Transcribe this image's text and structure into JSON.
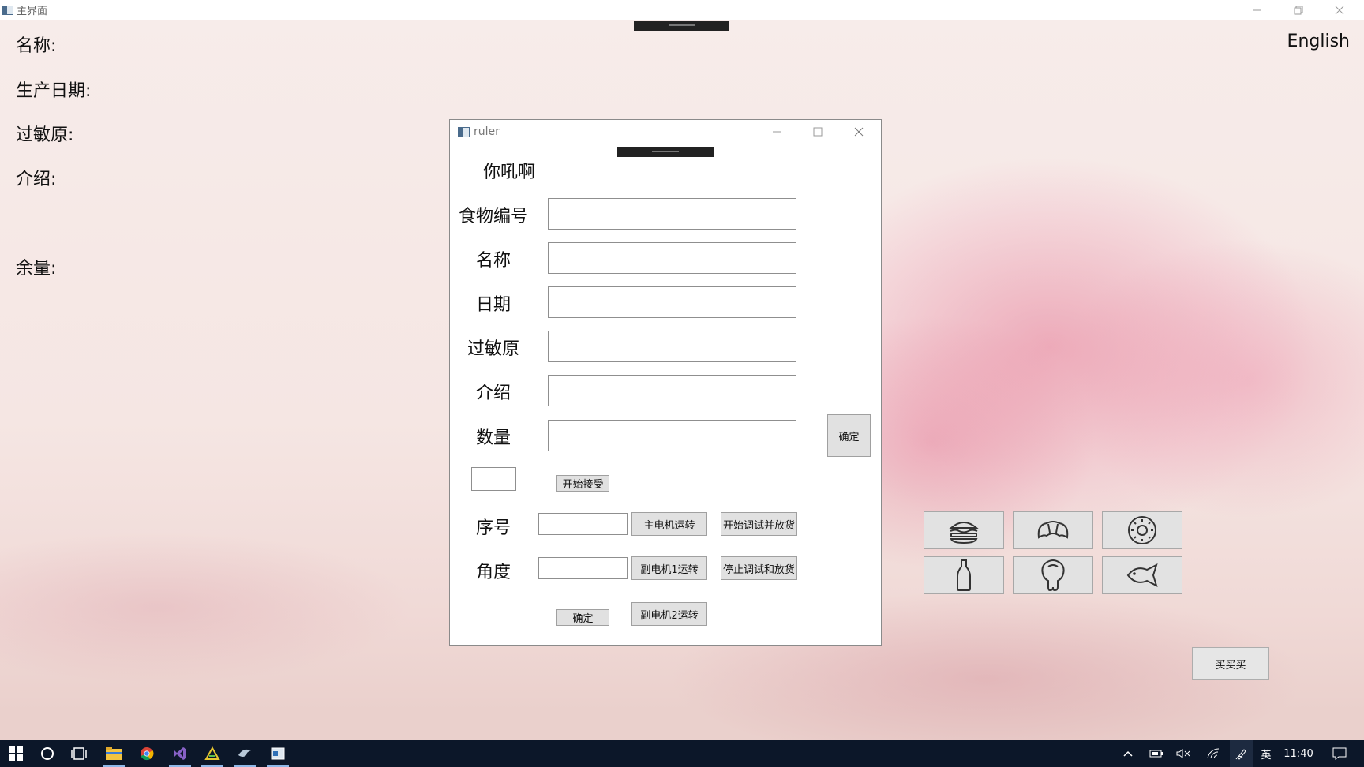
{
  "main_window": {
    "title": "主界面",
    "info_labels": {
      "name": "名称:",
      "production_date": "生产日期:",
      "allergen": "过敏原:",
      "intro": "介绍:",
      "remaining": "余量:"
    },
    "language_toggle": "English",
    "food_buttons": [
      "hamburger-icon",
      "croissant-icon",
      "donut-icon",
      "bottle-icon",
      "chicken-leg-icon",
      "fish-icon"
    ],
    "buy_button": "买买买"
  },
  "ruler_dialog": {
    "title": "ruler",
    "greeting": "你吼啊",
    "fields": {
      "food_id": {
        "label": "食物编号",
        "value": ""
      },
      "name": {
        "label": "名称",
        "value": ""
      },
      "date": {
        "label": "日期",
        "value": ""
      },
      "allergen": {
        "label": "过敏原",
        "value": ""
      },
      "intro": {
        "label": "介绍",
        "value": ""
      },
      "quantity": {
        "label": "数量",
        "value": ""
      }
    },
    "confirm_top": "确定",
    "receive_value": "",
    "start_receive": "开始接受",
    "serial_label": "序号",
    "serial_value": "",
    "angle_label": "角度",
    "angle_value": "",
    "main_motor_run": "主电机运转",
    "sub_motor1_run": "副电机1运转",
    "sub_motor2_run": "副电机2运转",
    "start_debug": "开始调试并放货",
    "stop_debug": "停止调试和放货",
    "confirm_bottom": "确定"
  },
  "taskbar": {
    "ime": "英",
    "clock": "11:40"
  },
  "colors": {
    "taskbar": "#0c1729",
    "button_face": "#e1e1e1",
    "blossom": "#e0789a"
  }
}
